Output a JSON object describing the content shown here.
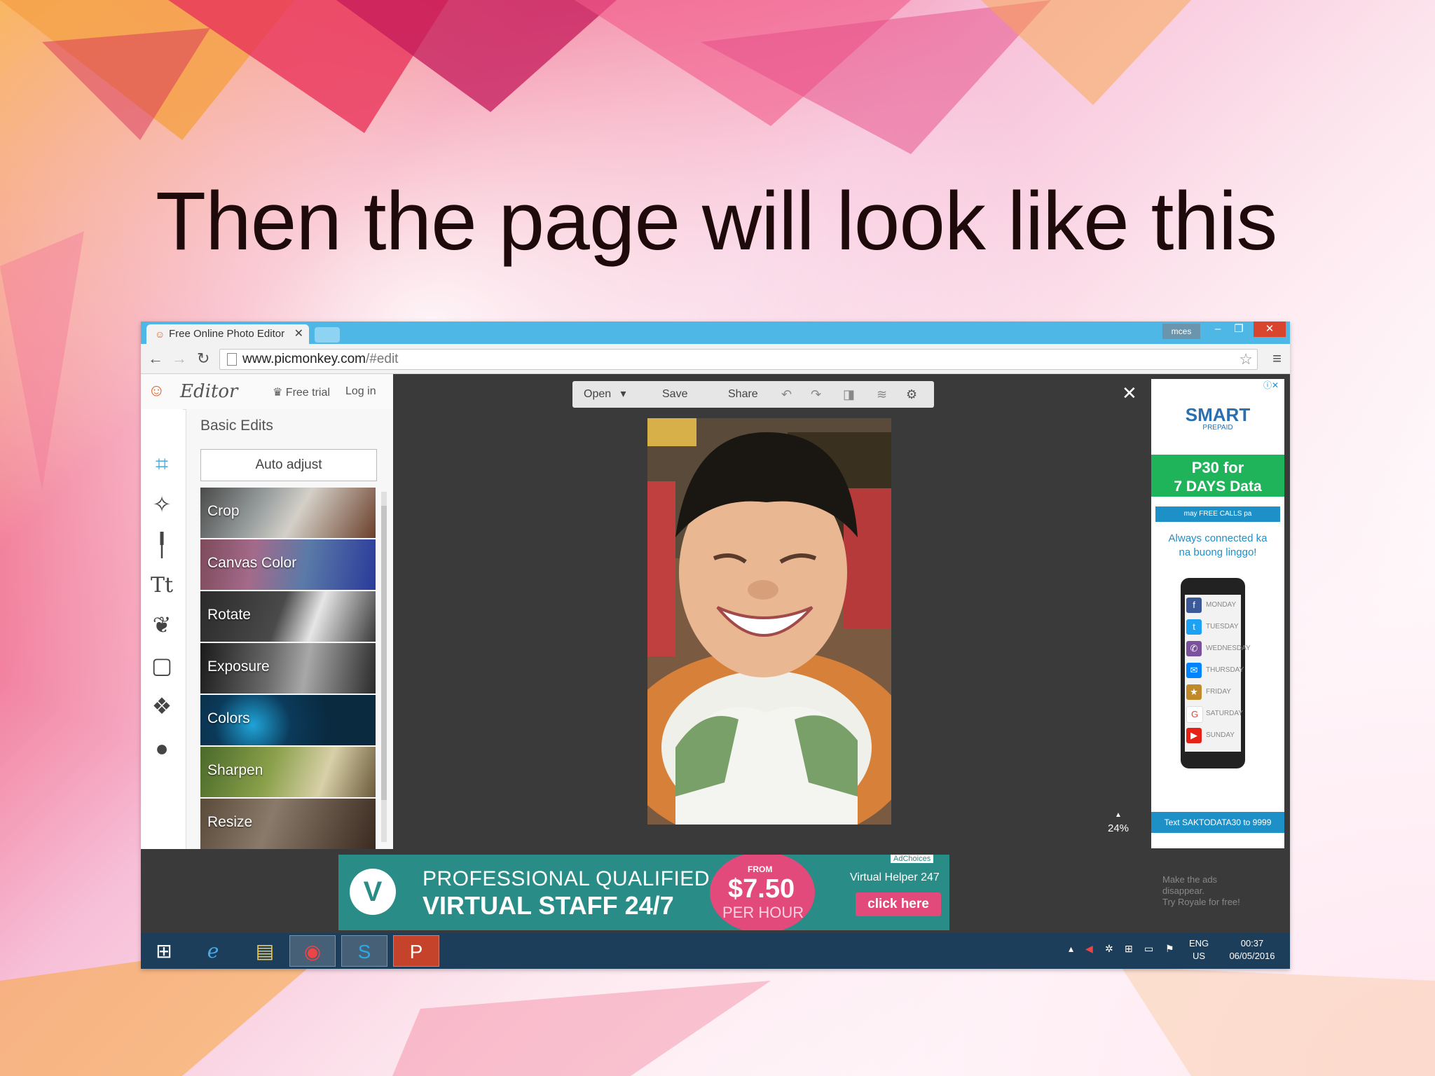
{
  "slide": {
    "title": "Then the page will look like this"
  },
  "browser": {
    "tab_title": "Free Online Photo Editor |",
    "user": "mces",
    "url_domain": "www.picmonkey.com",
    "url_path": "/#edit"
  },
  "editor": {
    "brand": "Editor",
    "free_trial": "Free trial",
    "login": "Log in",
    "section_title": "Basic Edits",
    "auto_adjust": "Auto adjust",
    "tools": [
      {
        "label": "Crop"
      },
      {
        "label": "Canvas Color"
      },
      {
        "label": "Rotate"
      },
      {
        "label": "Exposure"
      },
      {
        "label": "Colors"
      },
      {
        "label": "Sharpen"
      },
      {
        "label": "Resize"
      }
    ]
  },
  "toolbar": {
    "open": "Open",
    "save": "Save",
    "share": "Share"
  },
  "canvas": {
    "zoom": "24%"
  },
  "side_ad": {
    "brand": "SMART",
    "sub": "PREPAID",
    "offer_line1": "P30 for",
    "offer_line2": "7 DAYS Data",
    "bar": "may FREE CALLS pa",
    "tag_line1": "Always connected ka",
    "tag_line2": "na buong linggo!",
    "days": [
      "MONDAY",
      "TUESDAY",
      "WEDNESDAY",
      "THURSDAY",
      "FRIDAY",
      "SATURDAY",
      "SUNDAY"
    ],
    "footer": "Text SAKTODATA30 to 9999"
  },
  "banner_ad": {
    "line1": "PROFESSIONAL QUALIFIED",
    "line2": "VIRTUAL STAFF 24/7",
    "from": "FROM",
    "price": "$7.50",
    "per_hour": "PER HOUR",
    "brand": "Virtual Helper 247",
    "cta": "click here",
    "adchoices": "AdChoices",
    "ads_away1": "Make the ads",
    "ads_away2": "disappear.",
    "ads_away3": "Try Royale for free!"
  },
  "taskbar": {
    "lang1": "ENG",
    "lang2": "US",
    "time": "00:37",
    "date": "06/05/2016"
  }
}
